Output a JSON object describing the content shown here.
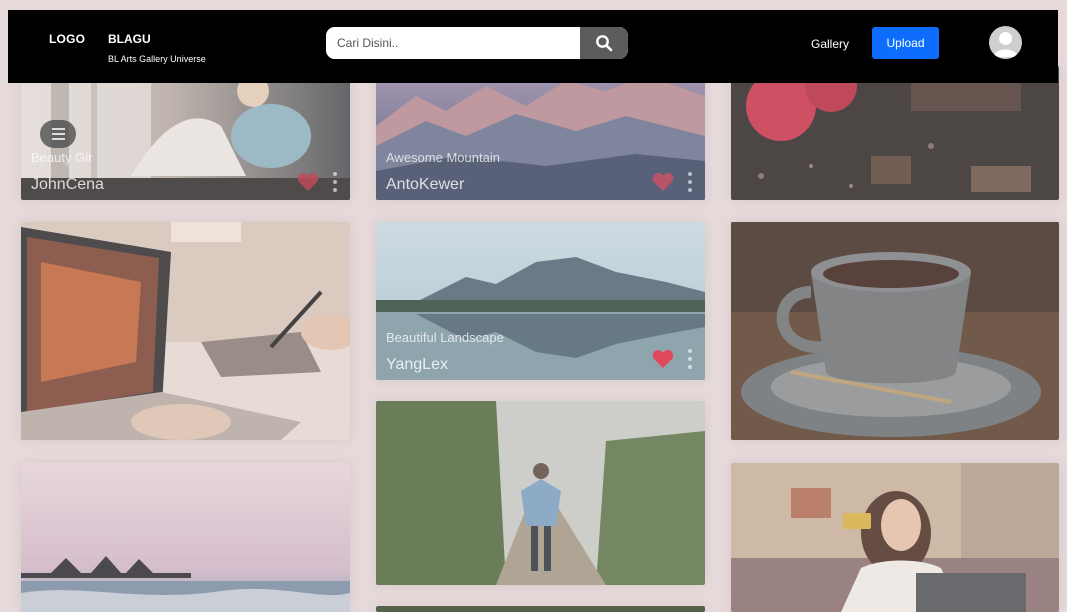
{
  "header": {
    "logo": "LOGO",
    "brand_title": "BLAGU",
    "brand_subtitle": "BL Arts Gallery Universe",
    "search_placeholder": "Cari Disini..",
    "nav_gallery": "Gallery",
    "upload_label": "Upload"
  },
  "cards": [
    {
      "id": "c1",
      "title": "Beauty Gir",
      "author": "JohnCena"
    },
    {
      "id": "c2",
      "title": "Awesome Mountain",
      "author": "AntoKewer"
    },
    {
      "id": "c3",
      "title": "",
      "author": ""
    },
    {
      "id": "c4",
      "title": "",
      "author": ""
    },
    {
      "id": "c5",
      "title": "Beautiful Landscape",
      "author": "YangLex"
    },
    {
      "id": "c6",
      "title": "",
      "author": ""
    },
    {
      "id": "c7",
      "title": "",
      "author": ""
    },
    {
      "id": "c8",
      "title": "",
      "author": ""
    },
    {
      "id": "c9",
      "title": "",
      "author": ""
    }
  ],
  "icons": {
    "search": "search-icon",
    "heart": "heart-icon",
    "kebab": "kebab-menu-icon",
    "menu": "hamburger-menu-icon",
    "avatar": "user-avatar-icon"
  },
  "colors": {
    "header_bg": "#000000",
    "upload_button": "#0d6efd",
    "page_bg": "#e6d9da",
    "heart": "#e0485c"
  }
}
